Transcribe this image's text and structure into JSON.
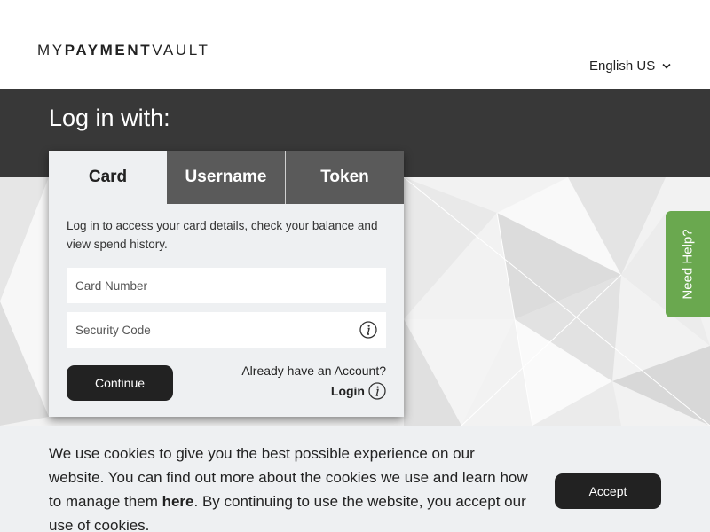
{
  "header": {
    "logo": {
      "part1": "MY",
      "part2": "PAYMENT",
      "part3": "VAULT"
    },
    "language": {
      "selected": "English US",
      "icon": "chevron-down-icon"
    }
  },
  "banner": {
    "title": "Log in with:"
  },
  "login_panel": {
    "tabs": [
      {
        "label": "Card",
        "active": true
      },
      {
        "label": "Username",
        "active": false
      },
      {
        "label": "Token",
        "active": false
      }
    ],
    "intro": "Log in to access your card details, check your balance and view spend history.",
    "fields": {
      "card_number": {
        "placeholder": "Card Number",
        "value": ""
      },
      "security_code": {
        "placeholder": "Security Code",
        "value": "",
        "icon": "info-icon"
      }
    },
    "continue_label": "Continue",
    "already_account": "Already have an Account?",
    "login_label": "Login",
    "login_icon": "info-icon"
  },
  "help_tab": {
    "label": "Need Help?",
    "color": "#6aa84f"
  },
  "cookie_banner": {
    "text_before": "We use cookies to give you the best possible experience on our website. You can find out more about the cookies we use and learn how to manage them ",
    "link_label": "here",
    "text_after": ". By continuing to use the website, you accept our use of cookies.",
    "accept_label": "Accept"
  },
  "colors": {
    "band": "#383838",
    "inactive_tab": "#5a5a5a",
    "button": "#222222",
    "help_green": "#6aa84f"
  }
}
